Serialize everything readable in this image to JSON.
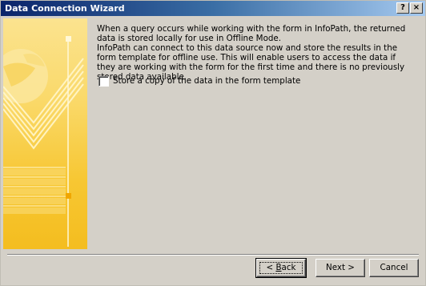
{
  "window": {
    "title": "Data Connection Wizard",
    "help_glyph": "?",
    "close_glyph": "×"
  },
  "main": {
    "paragraph1": "When a query occurs while working with the form in InfoPath, the returned data is stored locally for use in Offline Mode.",
    "paragraph2": "InfoPath can connect to this data source now and store the results in the form template for offline use. This will enable users to access the data if they are working with the form for the first time and there is no previously stored data available.",
    "checkbox": {
      "label": "Store a copy of the data in the form template",
      "checked": false
    }
  },
  "buttons": {
    "back_prefix": "< ",
    "back_key": "B",
    "back_suffix": "ack",
    "next_label": "Next >",
    "cancel_label": "Cancel"
  },
  "colors": {
    "titlebar_start": "#0a246a",
    "titlebar_end": "#a6caf0",
    "dialog_bg": "#d4d0c8",
    "art_yellow": "#f7c733"
  }
}
